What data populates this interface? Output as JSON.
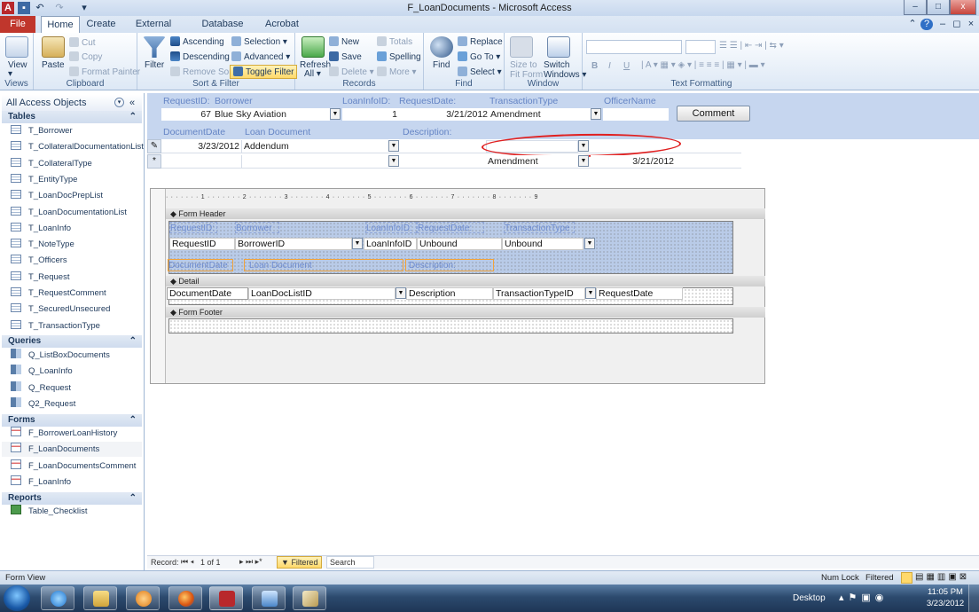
{
  "window": {
    "title": "F_LoanDocuments - Microsoft Access",
    "minimize": "–",
    "maximize": "□",
    "close": "x"
  },
  "tabs": [
    "File",
    "Home",
    "Create",
    "External Data",
    "Database Tools",
    "Acrobat"
  ],
  "ribbon": {
    "views": {
      "view": "View",
      "group": "Views"
    },
    "clipboard": {
      "paste": "Paste",
      "cut": "Cut",
      "copy": "Copy",
      "format_painter": "Format Painter",
      "group": "Clipboard"
    },
    "sort": {
      "filter": "Filter",
      "ascending": "Ascending",
      "descending": "Descending",
      "remove_sort": "Remove Sort",
      "selection": "Selection ▾",
      "advanced": "Advanced ▾",
      "toggle_filter": "Toggle Filter",
      "group": "Sort & Filter"
    },
    "records": {
      "refresh": "Refresh",
      "refresh_all": "All ▾",
      "new": "New",
      "save": "Save",
      "delete": "Delete ▾",
      "totals": "Totals",
      "spelling": "Spelling",
      "more": "More ▾",
      "group": "Records"
    },
    "find": {
      "find": "Find",
      "replace": "Replace",
      "goto": "Go To ▾",
      "select": "Select ▾",
      "group": "Find"
    },
    "window": {
      "size_to_fit": "Size to",
      "size_to_fit2": "Fit Form",
      "switch": "Switch",
      "switch2": "Windows ▾",
      "group": "Window"
    },
    "text": {
      "bold": "B",
      "italic": "I",
      "underline": "U",
      "group": "Text Formatting"
    }
  },
  "nav": {
    "header": "All Access Objects",
    "tables_label": "Tables",
    "tables": [
      "T_Borrower",
      "T_CollateralDocumentationList",
      "T_CollateralType",
      "T_EntityType",
      "T_LoanDocPrepList",
      "T_LoanDocumentationList",
      "T_LoanInfo",
      "T_NoteType",
      "T_Officers",
      "T_Request",
      "T_RequestComment",
      "T_SecuredUnsecured",
      "T_TransactionType"
    ],
    "queries_label": "Queries",
    "queries": [
      "Q_ListBoxDocuments",
      "Q_LoanInfo",
      "Q_Request",
      "Q2_Request"
    ],
    "forms_label": "Forms",
    "forms": [
      "F_BorrowerLoanHistory",
      "F_LoanDocuments",
      "F_LoanDocumentsComment",
      "F_LoanInfo"
    ],
    "reports_label": "Reports",
    "reports": [
      "Table_Checklist"
    ]
  },
  "form": {
    "labels": {
      "request_id": "RequestID:",
      "borrower": "Borrower",
      "loaninfo_id": "LoanInfoID:",
      "request_date": "RequestDate:",
      "transaction_type": "TransactionType",
      "officer_name": "OfficerName",
      "document_date": "DocumentDate",
      "loan_document": "Loan Document",
      "description": "Description:"
    },
    "values": {
      "request_id": "67",
      "borrower": "Blue Sky Aviation",
      "loaninfo_id": "1",
      "request_date": "3/21/2012",
      "transaction_type": "Amendment",
      "officer_name": ""
    },
    "comment_button": "Comment",
    "rows": [
      {
        "selector": "✎",
        "document_date": "3/23/2012",
        "loan_document": "Addendum",
        "description": "",
        "type": "",
        "date": ""
      },
      {
        "selector": "*",
        "document_date": "",
        "loan_document": "",
        "description": "",
        "type": "Amendment",
        "date": "3/21/2012"
      }
    ]
  },
  "design": {
    "ruler": "· · · · · · · 1 · · · · · · · 2 · · · · · · · 3 · · · · · · · 4 · · · · · · · 5 · · · · · · · 6 · · · · · · · 7 · · · · · · · 8 · · · · · · · 9",
    "form_header": "Form Header",
    "detail": "Detail",
    "form_footer": "Form Footer",
    "header_labels": [
      "RequestID:",
      "Borrower",
      "LoanInfoID:",
      "RequestDate:",
      "TransactionType"
    ],
    "header_controls": [
      "RequestID",
      "BorrowerID",
      "LoanInfoID",
      "Unbound",
      "Unbound"
    ],
    "header_row2_labels": [
      "DocumentDate",
      "Loan Document",
      "Description:"
    ],
    "detail_controls": [
      "DocumentDate",
      "LoanDocListID",
      "Description",
      "TransactionTypeID",
      "RequestDate"
    ]
  },
  "recnav": {
    "record": "Record:",
    "position": "1 of 1",
    "filtered": "Filtered",
    "search": "Search"
  },
  "status": {
    "left": "Form View",
    "numlock": "Num Lock",
    "filtered": "Filtered"
  },
  "taskbar": {
    "desktop": "Desktop",
    "time": "11:05 PM",
    "date": "3/23/2012"
  }
}
